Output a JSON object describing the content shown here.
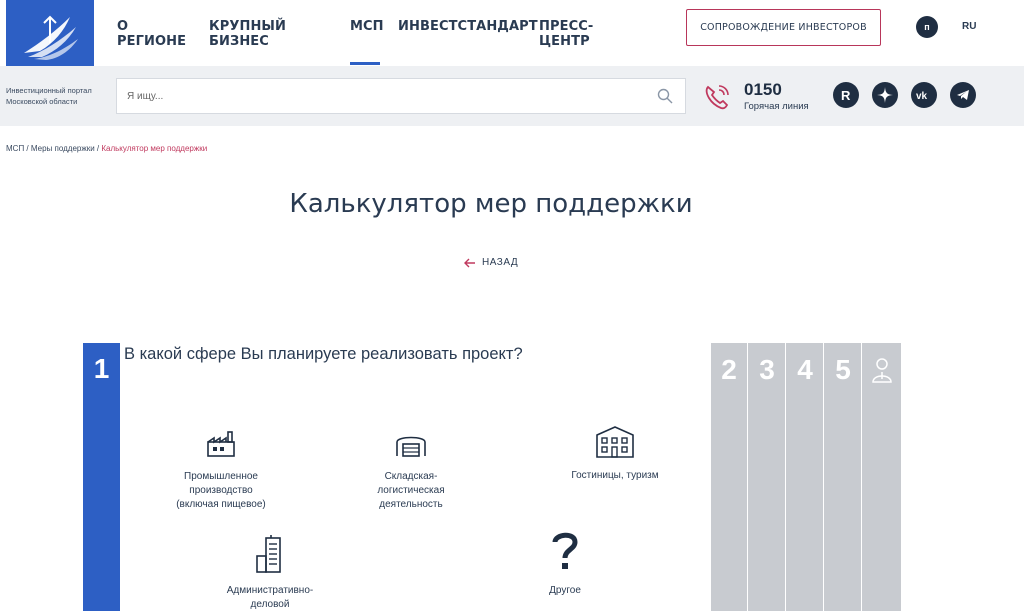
{
  "header": {
    "nav": [
      "О РЕГИОНЕ",
      "КРУПНЫЙ БИЗНЕС",
      "МСП",
      "ИНВЕСТСТАНДАРТ",
      "ПРЕСС-ЦЕНТР"
    ],
    "active_nav": "МСП",
    "investor_button": "СОПРОВОЖДЕНИЕ ИНВЕСТОРОВ",
    "user_initial": "п",
    "lang": "RU"
  },
  "subbar": {
    "portal_text": "Инвестиционный портал Московской области",
    "search_placeholder": "Я ищу...",
    "hotline_number": "0150",
    "hotline_label": "Горячая линия",
    "social_icons": [
      "rutube-icon",
      "zen-icon",
      "vk-icon",
      "telegram-icon"
    ]
  },
  "breadcrumb": {
    "items": [
      "МСП",
      "Меры поддержки"
    ],
    "separator": " / ",
    "current": "Калькулятор мер поддержки"
  },
  "page": {
    "title": "Калькулятор мер поддержки",
    "back_label": "НАЗАД"
  },
  "calculator": {
    "active_step": "1",
    "question": "В какой сфере Вы планируете реализовать проект?",
    "options": [
      {
        "label": "Промышленное производство (включая пищевое)",
        "icon": "factory-icon"
      },
      {
        "label": "Складская-логистическая деятельность",
        "icon": "warehouse-icon"
      },
      {
        "label": "Гостиницы, туризм",
        "icon": "hotel-icon"
      },
      {
        "label": "Административно-деловой",
        "icon": "office-building-icon"
      },
      {
        "label": "Другое",
        "icon": "question-icon"
      }
    ],
    "remaining_steps": [
      "2",
      "3",
      "4",
      "5"
    ],
    "final_step_icon": "person-icon"
  },
  "colors": {
    "brand_blue": "#2d5fc4",
    "accent_pink": "#c0395e",
    "dark_text": "#2a3b52",
    "step_gray": "#c8cbd0"
  }
}
